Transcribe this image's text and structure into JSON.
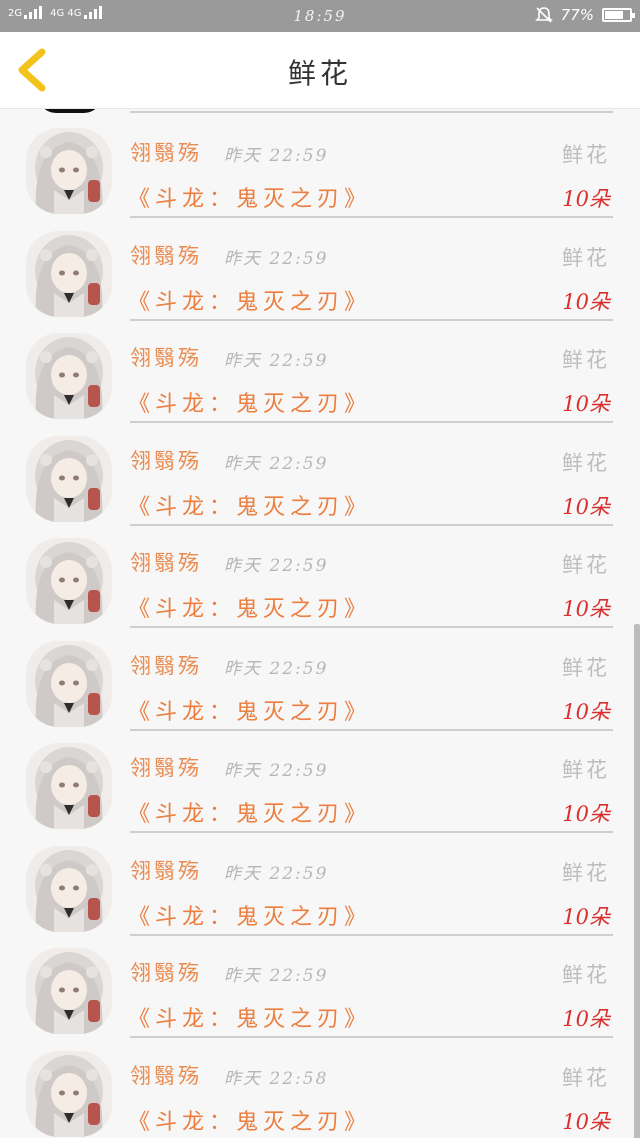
{
  "status_bar": {
    "sim1": "2G",
    "sim2": "4G 4G",
    "time": "18:59",
    "battery": "77%",
    "battery_level": 0.77
  },
  "header": {
    "title": "鲜花",
    "back_icon": "chevron-left-icon",
    "back_color": "#f2c31b"
  },
  "records": [
    {
      "name": "翎翳殇",
      "time": "昨天 22:59",
      "gift": "鲜花",
      "book": "《斗龙：鬼灭之刃》",
      "count": "10朵"
    },
    {
      "name": "翎翳殇",
      "time": "昨天 22:59",
      "gift": "鲜花",
      "book": "《斗龙：鬼灭之刃》",
      "count": "10朵"
    },
    {
      "name": "翎翳殇",
      "time": "昨天 22:59",
      "gift": "鲜花",
      "book": "《斗龙：鬼灭之刃》",
      "count": "10朵"
    },
    {
      "name": "翎翳殇",
      "time": "昨天 22:59",
      "gift": "鲜花",
      "book": "《斗龙：鬼灭之刃》",
      "count": "10朵"
    },
    {
      "name": "翎翳殇",
      "time": "昨天 22:59",
      "gift": "鲜花",
      "book": "《斗龙：鬼灭之刃》",
      "count": "10朵"
    },
    {
      "name": "翎翳殇",
      "time": "昨天 22:59",
      "gift": "鲜花",
      "book": "《斗龙：鬼灭之刃》",
      "count": "10朵"
    },
    {
      "name": "翎翳殇",
      "time": "昨天 22:59",
      "gift": "鲜花",
      "book": "《斗龙：鬼灭之刃》",
      "count": "10朵"
    },
    {
      "name": "翎翳殇",
      "time": "昨天 22:59",
      "gift": "鲜花",
      "book": "《斗龙：鬼灭之刃》",
      "count": "10朵"
    },
    {
      "name": "翎翳殇",
      "time": "昨天 22:59",
      "gift": "鲜花",
      "book": "《斗龙：鬼灭之刃》",
      "count": "10朵"
    },
    {
      "name": "翎翳殇",
      "time": "昨天 22:58",
      "gift": "鲜花",
      "book": "《斗龙：鬼灭之刃》",
      "count": "10朵"
    }
  ],
  "colors": {
    "name": "#e98a4f",
    "book": "#ec7e3f",
    "count": "#d9302f",
    "muted": "#b6b6b6"
  }
}
